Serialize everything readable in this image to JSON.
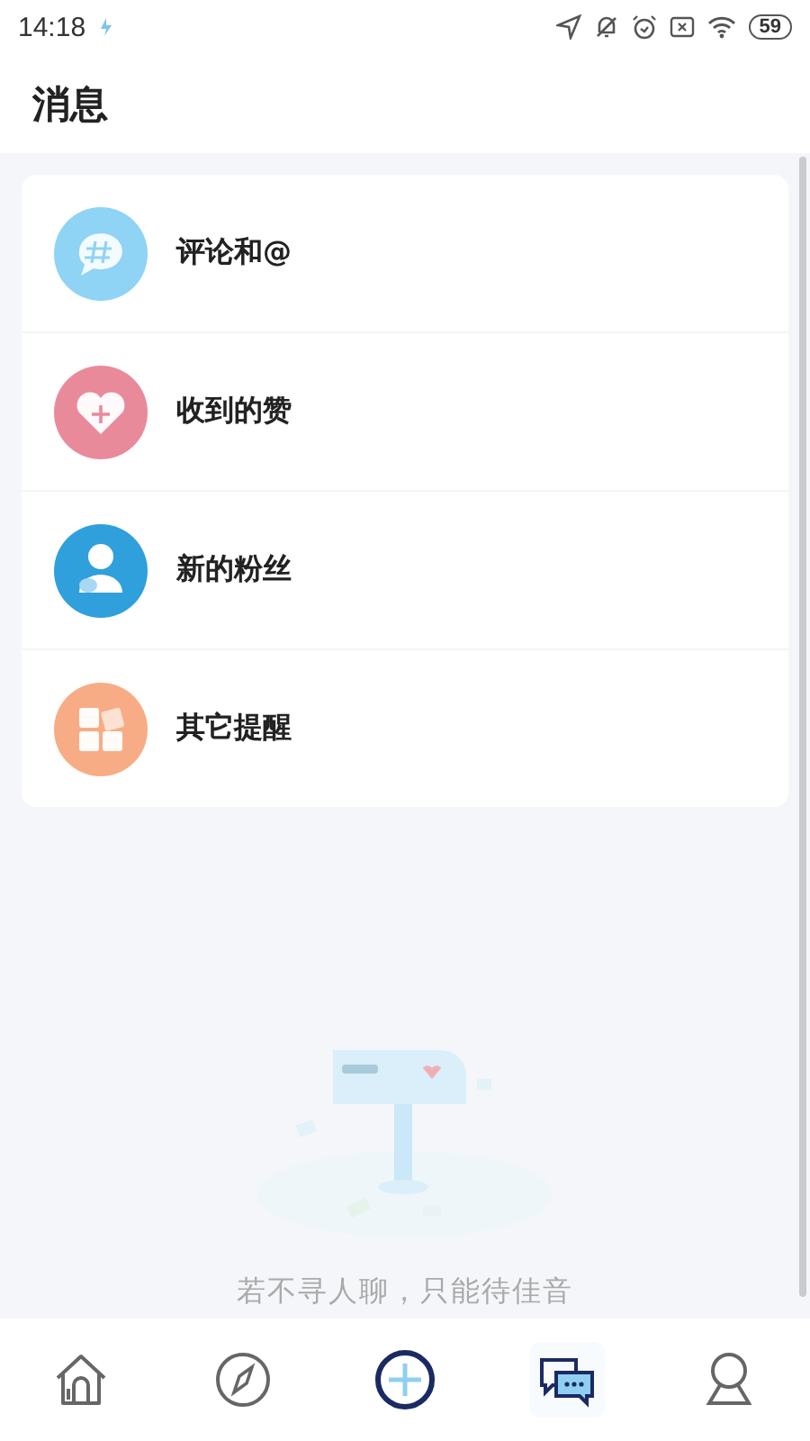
{
  "status_bar": {
    "time": "14:18",
    "battery": "59"
  },
  "header": {
    "title": "消息"
  },
  "items": [
    {
      "kind": "comment",
      "label": "评论和@",
      "color": "#8fd3f5"
    },
    {
      "kind": "like",
      "label": "收到的赞",
      "color": "#e98a9a"
    },
    {
      "kind": "fans",
      "label": "新的粉丝",
      "color": "#2fa0db"
    },
    {
      "kind": "other",
      "label": "其它提醒",
      "color": "#f8ac85"
    }
  ],
  "empty_state": {
    "text": "若不寻人聊，只能待佳音"
  },
  "nav": [
    {
      "kind": "home",
      "selected": false
    },
    {
      "kind": "discover",
      "selected": false
    },
    {
      "kind": "add",
      "selected": false
    },
    {
      "kind": "messages",
      "selected": true
    },
    {
      "kind": "profile",
      "selected": false
    }
  ]
}
